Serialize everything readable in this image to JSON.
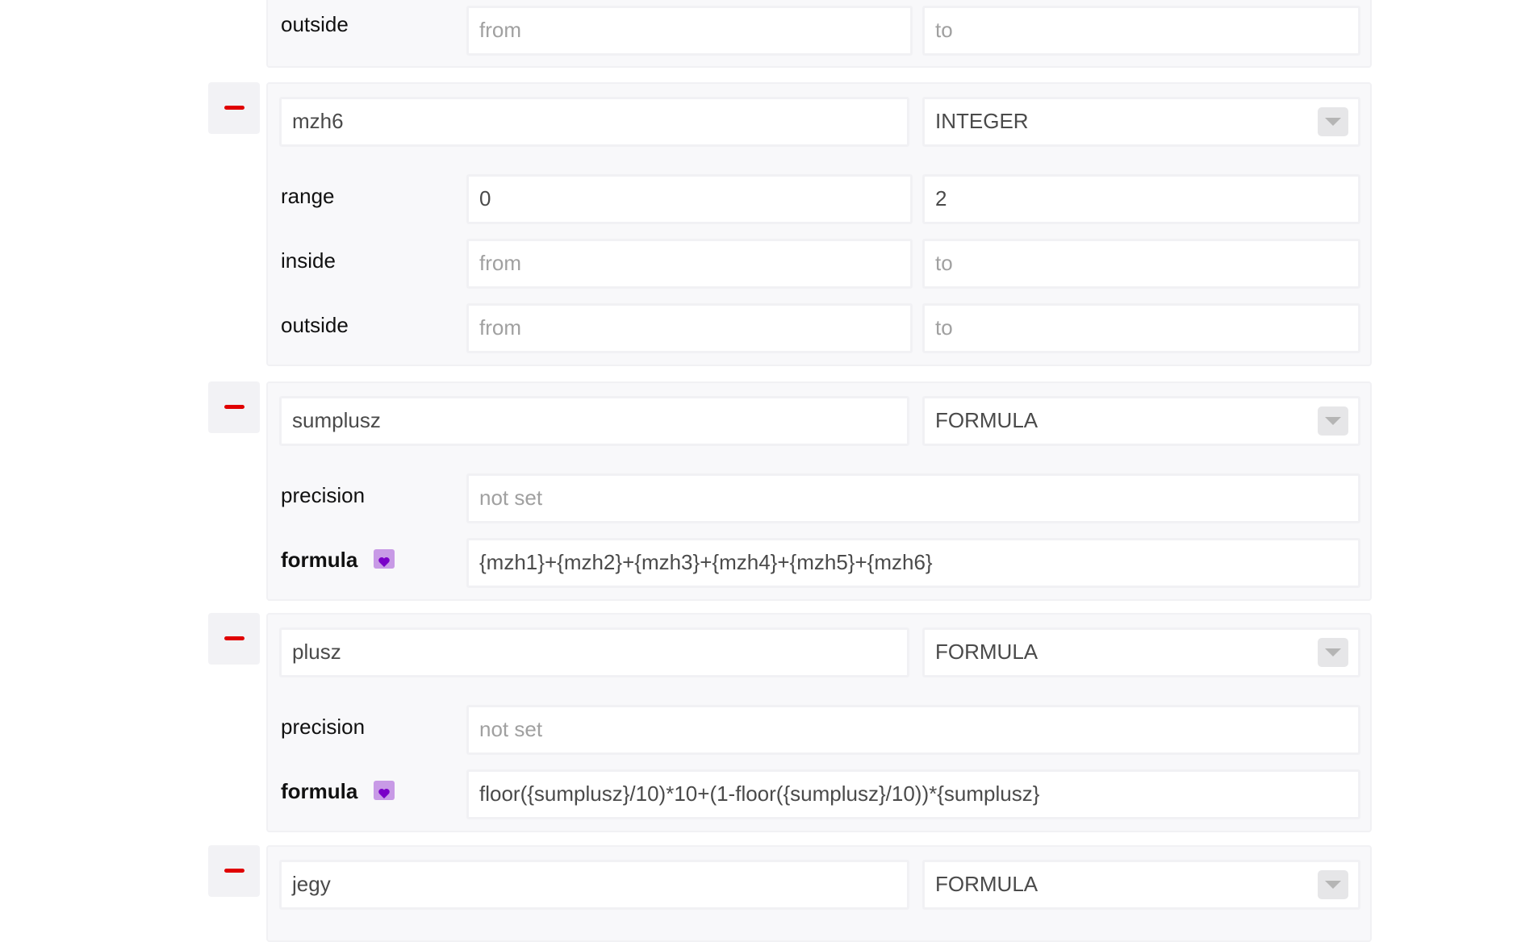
{
  "partial_top": {
    "rows": [
      {
        "label": "outside",
        "from_placeholder": "from",
        "to_placeholder": "to"
      }
    ]
  },
  "variables": [
    {
      "name": "mzh6",
      "type": "INTEGER",
      "rows": [
        {
          "label": "range",
          "from": "0",
          "to": "2"
        },
        {
          "label": "inside",
          "from_placeholder": "from",
          "to_placeholder": "to"
        },
        {
          "label": "outside",
          "from_placeholder": "from",
          "to_placeholder": "to"
        }
      ]
    },
    {
      "name": "sumplusz",
      "type": "FORMULA",
      "precision_label": "precision",
      "precision_placeholder": "not set",
      "formula_label": "formula",
      "formula": "{mzh1}+{mzh2}+{mzh3}+{mzh4}+{mzh5}+{mzh6}"
    },
    {
      "name": "plusz",
      "type": "FORMULA",
      "precision_label": "precision",
      "precision_placeholder": "not set",
      "formula_label": "formula",
      "formula": "floor({sumplusz}/10)*10+(1-floor({sumplusz}/10))*{sumplusz}"
    },
    {
      "name": "jegy",
      "type": "FORMULA"
    }
  ],
  "colors": {
    "remove_accent": "#e00000",
    "formula_badge": "#c89ae6",
    "formula_heart": "#7a00c8"
  },
  "icons": {
    "remove": "minus-icon",
    "dropdown": "chevron-down-icon",
    "formula_badge": "heart-icon"
  }
}
